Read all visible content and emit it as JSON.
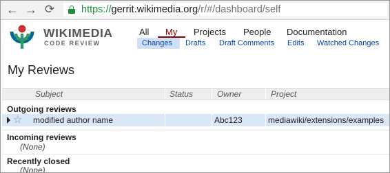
{
  "browser": {
    "back_glyph": "←",
    "forward_glyph": "→",
    "reload_glyph": "⟳",
    "url_scheme": "https://",
    "url_host": "gerrit.wikimedia.org",
    "url_path": "/r/#/dashboard/self",
    "secure_color": "#1e8e3e"
  },
  "brand": {
    "name": "WIKIMEDIA",
    "subtitle": "CODE REVIEW",
    "logo_icon": "wikimedia-logo"
  },
  "top_menu": {
    "all": "All",
    "my": "My",
    "projects": "Projects",
    "people": "People",
    "documentation": "Documentation",
    "active": "My",
    "active_color": "#8b0000"
  },
  "sub_menu": {
    "changes": "Changes",
    "drafts": "Drafts",
    "draft_comments": "Draft Comments",
    "edits": "Edits",
    "watched_changes": "Watched Changes",
    "active": "Changes",
    "link_color": "#0645ad"
  },
  "page": {
    "title": "My Reviews"
  },
  "table": {
    "headers": {
      "subject": "Subject",
      "status": "Status",
      "owner": "Owner",
      "project": "Project"
    },
    "sections": {
      "outgoing": "Outgoing reviews",
      "incoming": "Incoming reviews",
      "incoming_empty": "(None)",
      "recent": "Recently closed",
      "recent_empty": "(None)"
    },
    "rows": [
      {
        "star_icon": "☆",
        "subject": "modified author name",
        "status": "",
        "owner": "Abc123",
        "project": "mediawiki/extensions/examples"
      }
    ],
    "selected_row_color": "#d9e7f7"
  }
}
